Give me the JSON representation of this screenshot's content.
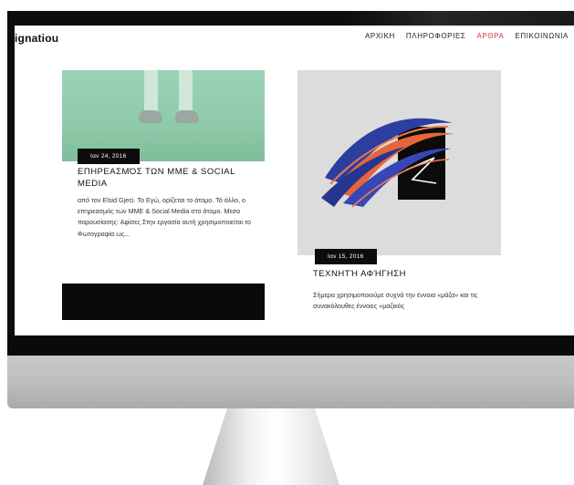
{
  "site": {
    "logo": "ignatiou",
    "nav": [
      {
        "label": "ΑΡΧΙΚΗ",
        "active": false
      },
      {
        "label": "ΠΛΗΡΟΦΟΡΙΕΣ",
        "active": false
      },
      {
        "label": "ΑΡΘΡΑ",
        "active": true
      },
      {
        "label": "ΕΠΙΚΟΙΝΩΝΙΑ",
        "active": false
      }
    ],
    "accent_color": "#d9343c"
  },
  "posts": [
    {
      "date": "Ιαν 24, 2016",
      "title": "ΕΠΗΡΕΑΣΜΌΣ ΤΩΝ ΜΜΕ & SOCIAL MEDIA",
      "excerpt": "από τον Elsid Gjeci. Το Εγώ, ορίζεται το άτομο. Τό άλλο, ο επηρεασμός των ΜΜΕ & Social Media στο άτομο. Μεσο παρουσίασης: Αφίσες Στην εργασία αυτή χρησιμοποιείται το Φωτογραφία ως..."
    },
    {
      "date": "Ιαν 15, 2016",
      "title": "ΤΕΧΝΗΤΉ ΑΦΉΓΗΣΗ",
      "excerpt": "Σήμερα χρησιμοποιούμε συχνά την έννοια «μάζα» και τις συνακόλουθες έννοιες «μαζικός"
    }
  ]
}
